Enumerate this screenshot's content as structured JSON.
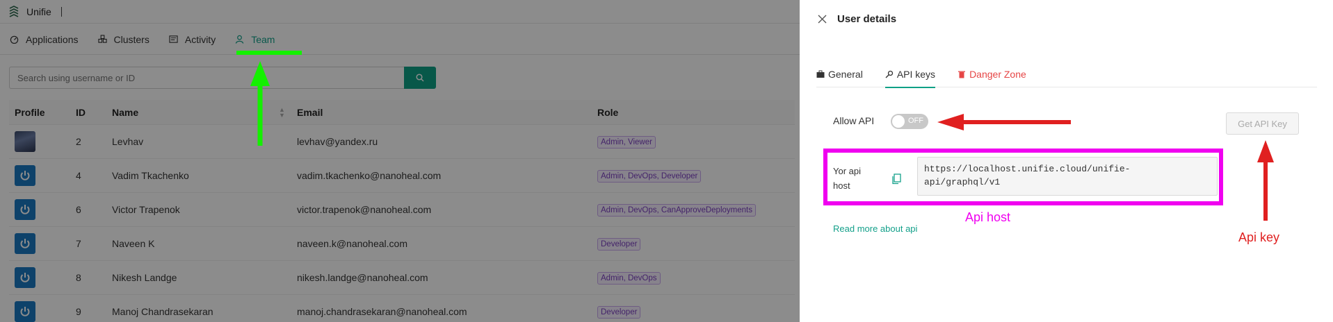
{
  "app": {
    "name": "Unifie"
  },
  "nav": [
    {
      "label": "Applications",
      "icon": "dashboard-icon"
    },
    {
      "label": "Clusters",
      "icon": "cluster-icon"
    },
    {
      "label": "Activity",
      "icon": "activity-icon"
    },
    {
      "label": "Team",
      "icon": "user-icon",
      "active": true
    }
  ],
  "search": {
    "placeholder": "Search using username or ID"
  },
  "table": {
    "headers": [
      "Profile",
      "ID",
      "Name",
      "Email",
      "Role"
    ],
    "rows": [
      {
        "id": "2",
        "name": "Levhav",
        "email": "levhav@yandex.ru",
        "role": "Admin, Viewer",
        "avatar": "photo"
      },
      {
        "id": "4",
        "name": "Vadim Tkachenko",
        "email": "vadim.tkachenko@nanoheal.com",
        "role": "Admin, DevOps, Developer",
        "avatar": "power"
      },
      {
        "id": "6",
        "name": "Victor Trapenok",
        "email": "victor.trapenok@nanoheal.com",
        "role": "Admin, DevOps, CanApproveDeployments",
        "avatar": "power"
      },
      {
        "id": "7",
        "name": "Naveen K",
        "email": "naveen.k@nanoheal.com",
        "role": "Developer",
        "avatar": "power"
      },
      {
        "id": "8",
        "name": "Nikesh Landge",
        "email": "nikesh.landge@nanoheal.com",
        "role": "Admin, DevOps",
        "avatar": "power"
      },
      {
        "id": "9",
        "name": "Manoj Chandrasekaran",
        "email": "manoj.chandrasekaran@nanoheal.com",
        "role": "Developer",
        "avatar": "power"
      }
    ]
  },
  "drawer": {
    "title": "User details",
    "tabs": [
      {
        "label": "General",
        "icon": "briefcase-icon"
      },
      {
        "label": "API keys",
        "icon": "key-icon",
        "active": true
      },
      {
        "label": "Danger Zone",
        "icon": "trash-icon",
        "danger": true
      }
    ],
    "allow_api_label": "Allow API",
    "toggle_state": "OFF",
    "get_key_button": "Get API Key",
    "host_label_line1": "Yor api",
    "host_label_line2": "host",
    "host_line1": "https://localhost.unifie.cloud/unifie-",
    "host_line2": "api/graphql/v1",
    "read_more": "Read more about api"
  },
  "annotations": {
    "api_host": "Api host",
    "api_key": "Api key"
  },
  "colors": {
    "accent": "#0fa086",
    "danger": "#e64545",
    "annotation_green": "#14f000",
    "annotation_red": "#e02020",
    "annotation_magenta": "#f000f0"
  }
}
